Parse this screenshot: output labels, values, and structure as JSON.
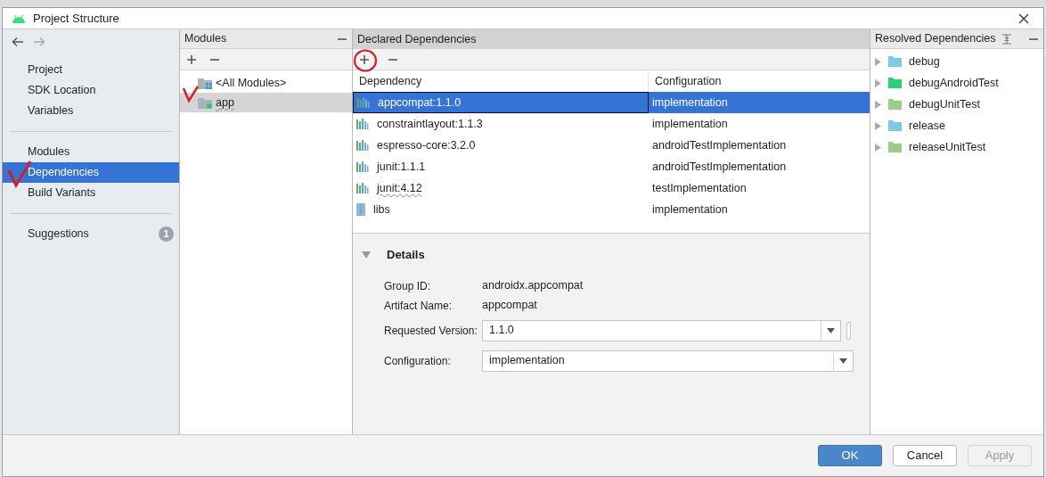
{
  "window": {
    "title": "Project Structure"
  },
  "sidebar": {
    "groups": [
      [
        {
          "label": "Project",
          "selected": false
        },
        {
          "label": "SDK Location",
          "selected": false
        },
        {
          "label": "Variables",
          "selected": false
        }
      ],
      [
        {
          "label": "Modules",
          "selected": false
        },
        {
          "label": "Dependencies",
          "selected": true
        },
        {
          "label": "Build Variants",
          "selected": false
        }
      ],
      [
        {
          "label": "Suggestions",
          "selected": false,
          "badge": "1"
        }
      ]
    ]
  },
  "modules": {
    "title": "Modules",
    "items": [
      {
        "label": "<All Modules>",
        "kind": "all",
        "selected": false,
        "spell_warning": false
      },
      {
        "label": "app",
        "kind": "module",
        "selected": true,
        "spell_warning": true
      }
    ]
  },
  "declared": {
    "title": "Declared Dependencies",
    "columns": [
      "Dependency",
      "Configuration"
    ],
    "rows": [
      {
        "dependency": "appcompat:1.1.0",
        "configuration": "implementation",
        "kind": "library",
        "selected": true,
        "spell_warning": false
      },
      {
        "dependency": "constraintlayout:1.1.3",
        "configuration": "implementation",
        "kind": "library",
        "selected": false,
        "spell_warning": false
      },
      {
        "dependency": "espresso-core:3.2.0",
        "configuration": "androidTestImplementation",
        "kind": "library",
        "selected": false,
        "spell_warning": false
      },
      {
        "dependency": "junit:1.1.1",
        "configuration": "androidTestImplementation",
        "kind": "library",
        "selected": false,
        "spell_warning": false
      },
      {
        "dependency": "junit:4.12",
        "configuration": "testImplementation",
        "kind": "library",
        "selected": false,
        "spell_warning": true
      },
      {
        "dependency": "libs",
        "configuration": "implementation",
        "kind": "jar",
        "selected": false,
        "spell_warning": false
      }
    ]
  },
  "details": {
    "title": "Details",
    "expanded": true,
    "fields": [
      {
        "label": "Group ID:",
        "value": "androidx.appcompat",
        "kind": "text"
      },
      {
        "label": "Artifact Name:",
        "value": "appcompat",
        "kind": "text"
      },
      {
        "label": "Requested Version:",
        "value": "1.1.0",
        "kind": "combo"
      },
      {
        "label": "Configuration:",
        "value": "implementation",
        "kind": "combo"
      }
    ]
  },
  "resolved": {
    "title": "Resolved Dependencies",
    "items": [
      {
        "label": "debug",
        "color": "#7ec8e8"
      },
      {
        "label": "debugAndroidTest",
        "color": "#2fcf7a"
      },
      {
        "label": "debugUnitTest",
        "color": "#9ccc8a"
      },
      {
        "label": "release",
        "color": "#7ec8e8"
      },
      {
        "label": "releaseUnitTest",
        "color": "#9ccc8a"
      }
    ]
  },
  "buttons": [
    {
      "label": "OK",
      "kind": "primary",
      "disabled": false
    },
    {
      "label": "Cancel",
      "kind": "normal",
      "disabled": false
    },
    {
      "label": "Apply",
      "kind": "normal",
      "disabled": true
    }
  ]
}
